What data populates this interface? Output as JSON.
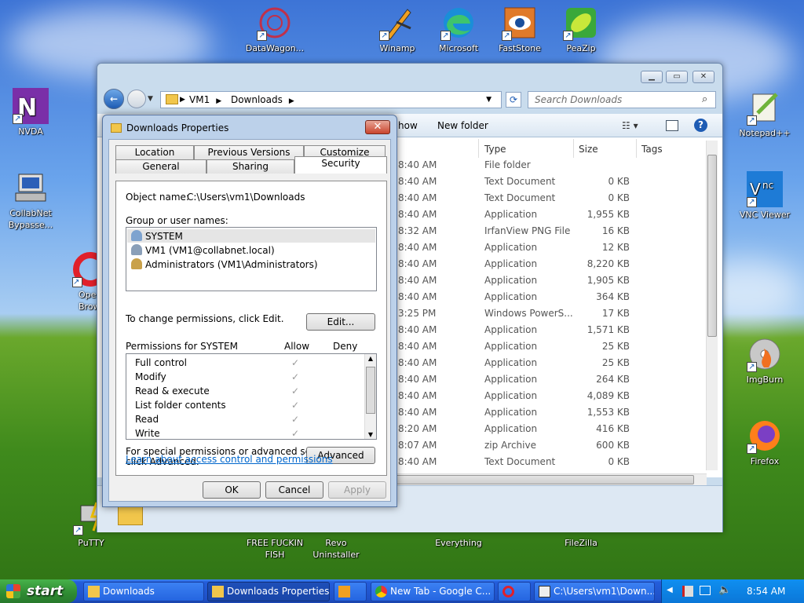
{
  "desktop": {
    "icons": [
      {
        "label": "DataWagon...",
        "icon": "datawagon-icon"
      },
      {
        "label": "Winamp",
        "icon": "winamp-icon"
      },
      {
        "label": "Microsoft",
        "icon": "edge-icon"
      },
      {
        "label": "FastStone",
        "icon": "faststone-icon"
      },
      {
        "label": "PeaZip",
        "icon": "peazip-icon"
      },
      {
        "label": "NVDA",
        "icon": "nvda-icon"
      },
      {
        "label": "CollabNet Bypasse...",
        "icon": "collabnet-icon"
      },
      {
        "label": "Ope Brow",
        "icon": "opera-icon"
      },
      {
        "label": "Notepad++",
        "icon": "notepadpp-icon"
      },
      {
        "label": "VNC Viewer",
        "icon": "vnc-icon"
      },
      {
        "label": "ImgBurn",
        "icon": "imgburn-icon"
      },
      {
        "label": "Firefox",
        "icon": "firefox-icon"
      },
      {
        "label": "PuTTY",
        "icon": "putty-icon"
      },
      {
        "label": "FREE FUCKIN FISH",
        "icon": "folder-icon"
      },
      {
        "label": "Revo Uninstaller",
        "icon": "revo-icon"
      },
      {
        "label": "Everything",
        "icon": "everything-icon"
      },
      {
        "label": "FileZilla",
        "icon": "filezilla-icon"
      }
    ]
  },
  "explorer": {
    "breadcrumb": [
      "VM1",
      "Downloads"
    ],
    "search_placeholder": "Search Downloads",
    "toolbar": {
      "show": "how",
      "new_folder": "New folder"
    },
    "columns": {
      "type": "Type",
      "size": "Size",
      "tags": "Tags"
    },
    "rows": [
      {
        "time": "8:40 AM",
        "type": "File folder",
        "size": ""
      },
      {
        "time": "8:40 AM",
        "type": "Text Document",
        "size": "0 KB"
      },
      {
        "time": "8:40 AM",
        "type": "Text Document",
        "size": "0 KB"
      },
      {
        "time": "8:40 AM",
        "type": "Application",
        "size": "1,955 KB"
      },
      {
        "time": "8:32 AM",
        "type": "IrfanView PNG File",
        "size": "16 KB"
      },
      {
        "time": "8:40 AM",
        "type": "Application",
        "size": "12 KB"
      },
      {
        "time": "8:40 AM",
        "type": "Application",
        "size": "8,220 KB"
      },
      {
        "time": "8:40 AM",
        "type": "Application",
        "size": "1,905 KB"
      },
      {
        "time": "8:40 AM",
        "type": "Application",
        "size": "364 KB"
      },
      {
        "time": "3:25 PM",
        "type": "Windows PowerS...",
        "size": "17 KB"
      },
      {
        "time": "8:40 AM",
        "type": "Application",
        "size": "1,571 KB"
      },
      {
        "time": "8:40 AM",
        "type": "Application",
        "size": "25 KB"
      },
      {
        "time": "8:40 AM",
        "type": "Application",
        "size": "25 KB"
      },
      {
        "time": "8:40 AM",
        "type": "Application",
        "size": "264 KB"
      },
      {
        "time": "8:40 AM",
        "type": "Application",
        "size": "4,089 KB"
      },
      {
        "time": "8:40 AM",
        "type": "Application",
        "size": "1,553 KB"
      },
      {
        "time": "8:20 AM",
        "type": "Application",
        "size": "416 KB"
      },
      {
        "time": "8:07 AM",
        "type": "zip Archive",
        "size": "600 KB"
      },
      {
        "time": "8:40 AM",
        "type": "Text Document",
        "size": "0 KB"
      }
    ]
  },
  "dialog": {
    "title": "Downloads Properties",
    "tabs_back": [
      "Location",
      "Previous Versions",
      "Customize"
    ],
    "tabs_front": [
      "General",
      "Sharing",
      "Security"
    ],
    "object_name_label": "Object name:",
    "object_name_value": "C:\\Users\\vm1\\Downloads",
    "group_label": "Group or user names:",
    "users": [
      "SYSTEM",
      "VM1 (VM1@collabnet.local)",
      "Administrators (VM1\\Administrators)"
    ],
    "change_text": "To change permissions, click Edit.",
    "edit_button": "Edit...",
    "permissions_label": "Permissions for SYSTEM",
    "allow_label": "Allow",
    "deny_label": "Deny",
    "permissions": [
      "Full control",
      "Modify",
      "Read & execute",
      "List folder contents",
      "Read",
      "Write"
    ],
    "check_glyph": "✓",
    "special_text_1": "For special permissions or advanced settings,",
    "special_text_2": "click Advanced.",
    "advanced_button": "Advanced",
    "learn_link": "Learn about access control and permissions",
    "ok_button": "OK",
    "cancel_button": "Cancel",
    "apply_button": "Apply"
  },
  "taskbar": {
    "start_label": "start",
    "buttons": [
      "Downloads",
      "Downloads Properties",
      "",
      "New Tab - Google C...",
      "",
      "C:\\Users\\vm1\\Down..."
    ],
    "clock": "8:54 AM"
  }
}
